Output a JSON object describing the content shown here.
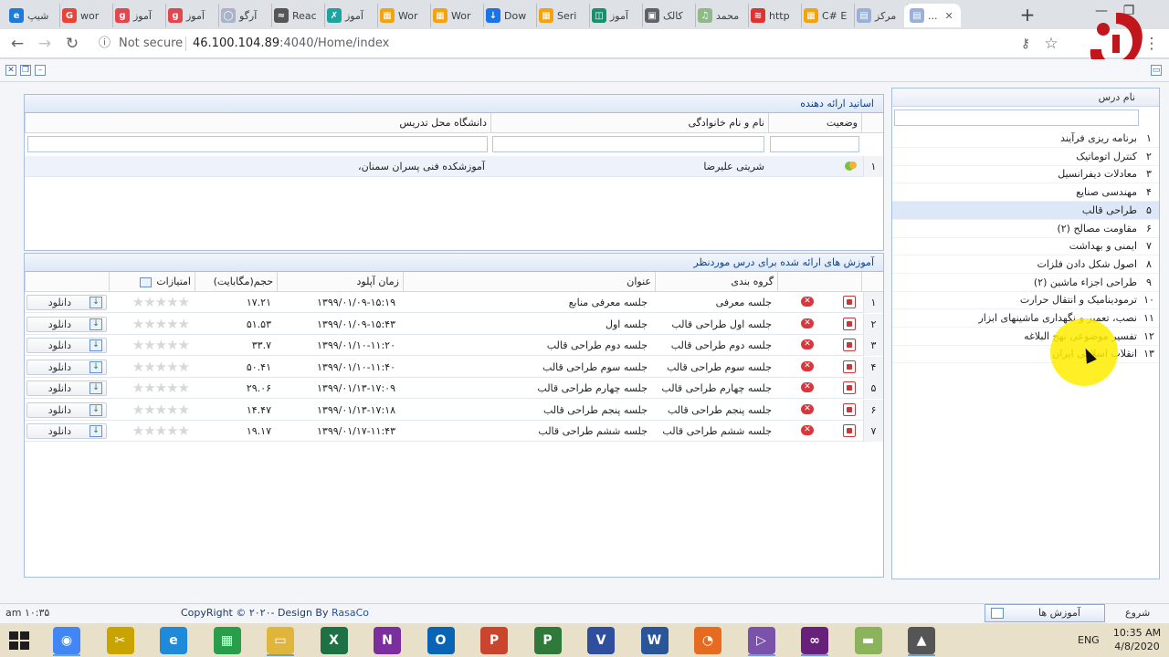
{
  "browser": {
    "tabs": [
      {
        "label": "شیپ",
        "color": "#1f7ad8",
        "glyph": "e"
      },
      {
        "label": "wor",
        "color": "#ea4335",
        "glyph": "G"
      },
      {
        "label": "آموز",
        "color": "#e2474f",
        "glyph": "g"
      },
      {
        "label": "آموز",
        "color": "#e2474f",
        "glyph": "g"
      },
      {
        "label": "آرگو",
        "color": "#a9b3c9",
        "glyph": "◯"
      },
      {
        "label": "Reac",
        "color": "#555",
        "glyph": "≈"
      },
      {
        "label": "آموز",
        "color": "#1fa3a0",
        "glyph": "✗"
      },
      {
        "label": "Wor",
        "color": "#f3a40c",
        "glyph": "▦"
      },
      {
        "label": "Wor",
        "color": "#f3a40c",
        "glyph": "▦"
      },
      {
        "label": "Dow",
        "color": "#1a73e8",
        "glyph": "↓"
      },
      {
        "label": "Seri",
        "color": "#f3a40c",
        "glyph": "▦"
      },
      {
        "label": "آموز",
        "color": "#1a8f6f",
        "glyph": "◫"
      },
      {
        "label": "کالک",
        "color": "#5f6368",
        "glyph": "▣"
      },
      {
        "label": "محمد",
        "color": "#8fb98a",
        "glyph": "♫"
      },
      {
        "label": "http",
        "color": "#d33",
        "glyph": "≋"
      },
      {
        "label": "C# E",
        "color": "#f3a40c",
        "glyph": "▦"
      },
      {
        "label": "مرکز",
        "color": "#9ab0d8",
        "glyph": "▤"
      },
      {
        "label": "...",
        "color": "#9ab0d8",
        "glyph": "▤"
      }
    ],
    "not_secure": "Not secure",
    "url_host": "46.100.104.89",
    "url_rest": ":4040/Home/index"
  },
  "teachers": {
    "title": "اساتید ارائه دهنده",
    "columns": {
      "status": "وضعیت",
      "name": "نام و نام خانوادگی",
      "university": "دانشگاه محل تدریس"
    },
    "rows": [
      {
        "num": "۱",
        "name": "شریتی علیرضا",
        "university": "آموزشکده فنی پسران سمنان،"
      }
    ]
  },
  "lessons": {
    "title": "آموزش های ارائه شده برای درس موردنظر",
    "columns": {
      "group": "گروه بندی",
      "title": "عنوان",
      "upload_time": "زمان آپلود",
      "size": "حجم(مگابایت)",
      "rating": "امتیازات"
    },
    "download_label": "دانلود",
    "rows": [
      {
        "num": "۱",
        "group": "جلسه معرفی",
        "title": "جلسه معرفی منابع",
        "upload_time": "۱۳۹۹/۰۱/۰۹-۱۵:۱۹",
        "size": "۱۷.۲۱"
      },
      {
        "num": "۲",
        "group": "جلسه اول طراحی قالب",
        "title": "جلسه اول",
        "upload_time": "۱۳۹۹/۰۱/۰۹-۱۵:۴۳",
        "size": "۵۱.۵۳"
      },
      {
        "num": "۳",
        "group": "جلسه دوم طراحی قالب",
        "title": "جلسه دوم طراحی قالب",
        "upload_time": "۱۳۹۹/۰۱/۱۰-۱۱:۲۰",
        "size": "۳۳.۷"
      },
      {
        "num": "۴",
        "group": "جلسه سوم طراحی قالب",
        "title": "جلسه سوم طراحی قالب",
        "upload_time": "۱۳۹۹/۰۱/۱۰-۱۱:۴۰",
        "size": "۵۰.۴۱"
      },
      {
        "num": "۵",
        "group": "جلسه چهارم طراحی قالب",
        "title": "جلسه چهارم طراحی قالب",
        "upload_time": "۱۳۹۹/۰۱/۱۳-۱۷:۰۹",
        "size": "۲۹.۰۶"
      },
      {
        "num": "۶",
        "group": "جلسه پنجم طراحی قالب",
        "title": "جلسه پنجم طراحی قالب",
        "upload_time": "۱۳۹۹/۰۱/۱۳-۱۷:۱۸",
        "size": "۱۴.۴۷"
      },
      {
        "num": "۷",
        "group": "جلسه ششم طراحی قالب",
        "title": "جلسه ششم طراحی قالب",
        "upload_time": "۱۳۹۹/۰۱/۱۷-۱۱:۴۳",
        "size": "۱۹.۱۷"
      }
    ]
  },
  "courses": {
    "header": "نام درس",
    "items": [
      {
        "num": "۱",
        "label": "برنامه ریزی فرآیند"
      },
      {
        "num": "۲",
        "label": "کنترل اتوماتیک"
      },
      {
        "num": "۳",
        "label": "معادلات دیفرانسیل"
      },
      {
        "num": "۴",
        "label": "مهندسی صنایع"
      },
      {
        "num": "۵",
        "label": "طراحی قالب",
        "selected": true
      },
      {
        "num": "۶",
        "label": "مقاومت مصالح (۲)"
      },
      {
        "num": "۷",
        "label": "ایمنی و بهداشت"
      },
      {
        "num": "۸",
        "label": "اصول شکل دادن فلزات"
      },
      {
        "num": "۹",
        "label": "طراحی اجزاء ماشین (۲)"
      },
      {
        "num": "۱۰",
        "label": "ترمودینامیک و انتقال حرارت"
      },
      {
        "num": "۱۱",
        "label": "نصب، تعمیر و نگهداری ماشینهای ابزار"
      },
      {
        "num": "۱۲",
        "label": "تفسیر موضوعی نهج البلاغه"
      },
      {
        "num": "۱۳",
        "label": "انقلاب اسلامی ایران"
      }
    ]
  },
  "statusbar": {
    "clock": "am ۱۰:۳۵",
    "copyright": "CopyRight © ۲۰۲۰- Design By",
    "brand": "RasaCo",
    "tab": "آموزش ها",
    "start": "شروع"
  },
  "taskbar": {
    "lang": "ENG",
    "time": "10:35 AM",
    "date": "4/8/2020",
    "apps": [
      {
        "name": "chrome",
        "color": "#4285f4",
        "glyph": "◉"
      },
      {
        "name": "tools",
        "color": "#c9a400",
        "glyph": "✂"
      },
      {
        "name": "ie",
        "color": "#1e8ad8",
        "glyph": "e"
      },
      {
        "name": "calc",
        "color": "#2a9d4a",
        "glyph": "▦"
      },
      {
        "name": "explorer",
        "color": "#e0b53c",
        "glyph": "▭"
      },
      {
        "name": "excel",
        "color": "#1d7144",
        "glyph": "X"
      },
      {
        "name": "onenote",
        "color": "#7b2f9e",
        "glyph": "N"
      },
      {
        "name": "outlook",
        "color": "#0a64b5",
        "glyph": "O"
      },
      {
        "name": "powerpoint",
        "color": "#c9452d",
        "glyph": "P"
      },
      {
        "name": "project",
        "color": "#2f7a3a",
        "glyph": "P"
      },
      {
        "name": "visio",
        "color": "#2f4f9e",
        "glyph": "V"
      },
      {
        "name": "word",
        "color": "#2a5699",
        "glyph": "W"
      },
      {
        "name": "firefox",
        "color": "#e66a1f",
        "glyph": "◔"
      },
      {
        "name": "vs-blend",
        "color": "#7b52ab",
        "glyph": "▷"
      },
      {
        "name": "visual-studio",
        "color": "#68217a",
        "glyph": "∞"
      },
      {
        "name": "app-green",
        "color": "#8bb35c",
        "glyph": "▬"
      },
      {
        "name": "app-dark",
        "color": "#555",
        "glyph": "▲"
      }
    ]
  }
}
